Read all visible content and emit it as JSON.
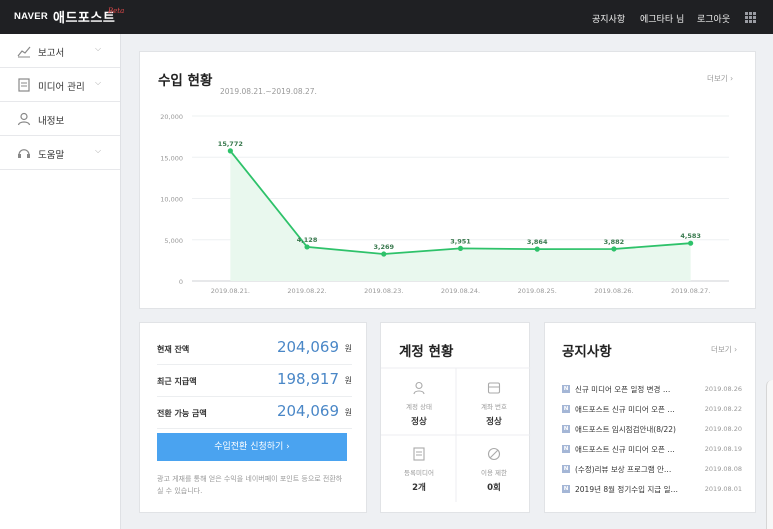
{
  "topbar": {
    "brand": "NAVER",
    "title": "애드포스트",
    "beta": "Beta",
    "nav": [
      "공지사항",
      "에그타타 님",
      "로그아웃"
    ]
  },
  "sidebar": {
    "items": [
      {
        "label": "보고서",
        "icon": "trend-icon"
      },
      {
        "label": "미디어 관리",
        "icon": "document-icon"
      },
      {
        "label": "내정보",
        "icon": "user-icon"
      },
      {
        "label": "도움말",
        "icon": "headset-icon"
      }
    ]
  },
  "revenue": {
    "title": "수입 현황",
    "date_range": "2019.08.21.~2019.08.27.",
    "more": "더보기 ›"
  },
  "chart_data": {
    "type": "area",
    "categories": [
      "2019.08.21.",
      "2019.08.22.",
      "2019.08.23.",
      "2019.08.24.",
      "2019.08.25.",
      "2019.08.26.",
      "2019.08.27."
    ],
    "values": [
      15772,
      4128,
      3269,
      3951,
      3864,
      3882,
      4583
    ],
    "data_labels": [
      "15,772",
      "4,128",
      "3,269",
      "3,951",
      "3,864",
      "3,882",
      "4,583"
    ],
    "y_ticks": [
      "0",
      "5,000",
      "10,000",
      "15,000",
      "20,000"
    ],
    "ylim": [
      0,
      20000
    ],
    "grid": true,
    "colors": {
      "line": "#2ec26a",
      "fill": "#e9f8ee"
    }
  },
  "balance": {
    "rows": [
      {
        "label": "현재 잔액",
        "value": "204,069",
        "unit": "원"
      },
      {
        "label": "최근 지급액",
        "value": "198,917",
        "unit": "원"
      },
      {
        "label": "전환 가능 금액",
        "value": "204,069",
        "unit": "원"
      }
    ],
    "button": "수입전환 신청하기  ›",
    "note": "광고 게재를 통해 얻은 수익을 네이버페이 포인트 등으로 전환하실 수 있습니다."
  },
  "account": {
    "title": "계정 현황",
    "cells": [
      {
        "label": "계정 상태",
        "value": "정상",
        "icon": "person-icon"
      },
      {
        "label": "계좌 번호",
        "value": "정상",
        "icon": "card-icon"
      },
      {
        "label": "등록미디어",
        "value": "2개",
        "icon": "media-icon"
      },
      {
        "label": "이용 제한",
        "value": "0회",
        "icon": "block-icon"
      }
    ]
  },
  "notices": {
    "title": "공지사항",
    "more": "더보기 ›",
    "badge": "N",
    "items": [
      {
        "text": "신규 미디어 오픈 일정 변경 …",
        "date": "2019.08.26"
      },
      {
        "text": "애드포스트 신규 미디어 오픈 …",
        "date": "2019.08.22"
      },
      {
        "text": "애드포스트 임시점검안내(8/22)",
        "date": "2019.08.20"
      },
      {
        "text": "애드포스트 신규 미디어 오픈 …",
        "date": "2019.08.19"
      },
      {
        "text": "(수정)리뷰 보상 프로그램 안…",
        "date": "2019.08.08"
      },
      {
        "text": "2019년 8월 정기수입 지급 일…",
        "date": "2019.08.01"
      }
    ]
  }
}
